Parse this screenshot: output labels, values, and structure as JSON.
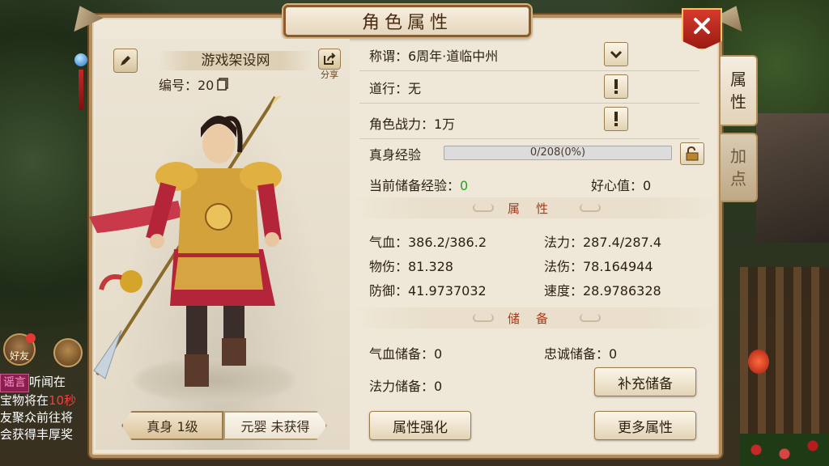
{
  "window": {
    "title": "角色属性"
  },
  "profile": {
    "name": "游戏架设网",
    "id_label": "编号：20",
    "share_label": "分享"
  },
  "form_tabs": {
    "active": "真身 1级",
    "inactive": "元婴 未获得"
  },
  "side_tabs": {
    "attributes": [
      "属",
      "性"
    ],
    "addpoint": [
      "加",
      "点"
    ]
  },
  "info": {
    "title_row": "称谓：6周年·道临中州",
    "daoxing_row": "道行：无",
    "power_row": "角色战力：1万",
    "exp_label": "真身经验",
    "exp_text": "0/208(0%)",
    "exp_progress": 0,
    "stored_exp_label": "当前储备经验：",
    "stored_exp_value": "0",
    "kindness": "好心值：0"
  },
  "attributes": {
    "heading": "属性",
    "hp": "气血：386.2/386.2",
    "mp": "法力：287.4/287.4",
    "phys_atk": "物伤：81.328",
    "mag_atk": "法伤：78.164944",
    "defense": "防御：41.9737032",
    "speed": "速度：28.9786328"
  },
  "reserve": {
    "heading": "储备",
    "hp_reserve": "气血储备：0",
    "loyalty_reserve": "忠诚储备：0",
    "mp_reserve": "法力储备：0",
    "refill_button": "补充储备"
  },
  "buttons": {
    "enhance": "属性强化",
    "more": "更多属性"
  },
  "hud": {
    "friend_label": "好友",
    "chat_tag": "谣言",
    "chat_line1": "听闻在",
    "chat_line2_a": "宝物将在",
    "chat_line2_b": "10秒",
    "chat_line3": "友聚众前往将",
    "chat_line4": "会获得丰厚奖"
  },
  "colors": {
    "panel_bg": "#efe7d8",
    "panel_border": "#b38e5c",
    "section_heading": "#a83a1c",
    "stored_exp_value": "#2e9b2e",
    "close_button": "#c62828"
  }
}
